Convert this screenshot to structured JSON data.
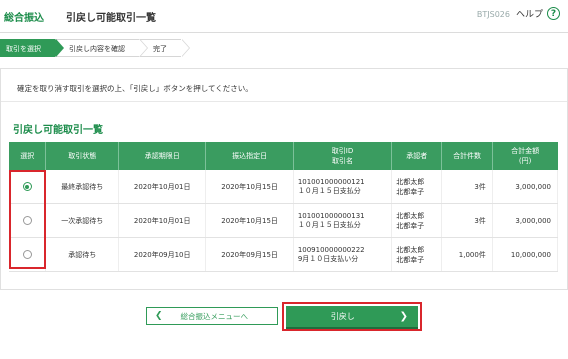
{
  "header": {
    "brand": "総合振込",
    "title": "引戻し可能取引一覧",
    "screen_id": "BTJS026",
    "help_label": "ヘルプ",
    "help_icon": "?"
  },
  "steps": [
    {
      "label": "取引を選択",
      "active": true
    },
    {
      "label": "引戻し内容を確認",
      "active": false
    },
    {
      "label": "完了",
      "active": false
    }
  ],
  "instruction": "確定を取り消す取引を選択の上、「引戻し」ボタンを押してください。",
  "section_title": "引戻し可能取引一覧",
  "table": {
    "headers": {
      "select": "選択",
      "status": "取引状態",
      "approval_deadline": "承認期限日",
      "transfer_date": "振込指定日",
      "id_line1": "取引ID",
      "id_line2": "取引名",
      "approver": "承認者",
      "total_count": "合計件数",
      "total_amount_line1": "合計金額",
      "total_amount_line2": "(円)"
    },
    "rows": [
      {
        "selected": true,
        "status": "最終承認待ち",
        "approval_deadline": "2020年10月01日",
        "transfer_date": "2020年10月15日",
        "id": "101001000000121",
        "name": "１０月１５日支払分",
        "approver1": "北都太郎",
        "approver2": "北都幸子",
        "count": "3件",
        "amount": "3,000,000"
      },
      {
        "selected": false,
        "status": "一次承認待ち",
        "approval_deadline": "2020年10月01日",
        "transfer_date": "2020年10月15日",
        "id": "101001000000131",
        "name": "１０月１５日支払分",
        "approver1": "北都太郎",
        "approver2": "北都幸子",
        "count": "3件",
        "amount": "3,000,000"
      },
      {
        "selected": false,
        "status": "承認待ち",
        "approval_deadline": "2020年09月10日",
        "transfer_date": "2020年09月15日",
        "id": "100910000000222",
        "name": "9月１０日支払い分",
        "approver1": "北都太郎",
        "approver2": "北都幸子",
        "count": "1,000件",
        "amount": "10,000,000"
      }
    ]
  },
  "buttons": {
    "back_label": "総合振込メニューへ",
    "back_icon": "chevron-left",
    "next_label": "引戻し",
    "next_icon": "chevron-right"
  },
  "colors": {
    "brand_green": "#2f9a57",
    "highlight_red": "#d9262c"
  }
}
